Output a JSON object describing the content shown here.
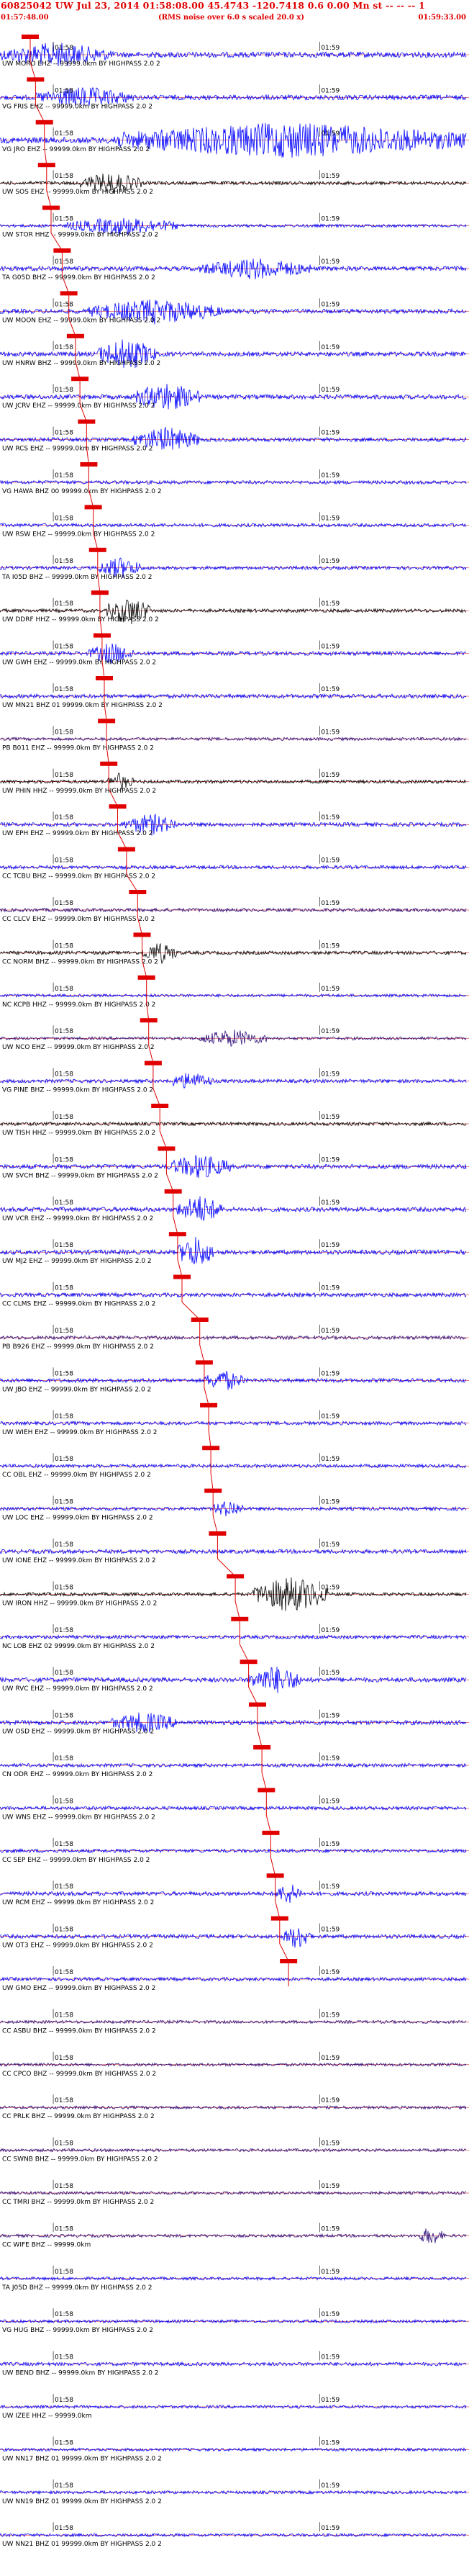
{
  "header": {
    "title": "60825042 UW Jul 23, 2014 01:58:08.00   45.4743 -120.7418  0.6 0.00 Mn st -- -- -- 1",
    "start_time": "01:57:48.00",
    "scale_note": "(RMS noise over 6.0 s scaled 20.0 x)",
    "end_time": "01:59:33.00",
    "colors": {
      "header": "#e00000",
      "pick": "#e00000",
      "trace_blue": "#0000ff",
      "trace_black": "#000000",
      "trace_purple": "#2a0a78",
      "baseline": "#d00000"
    }
  },
  "chart_data": {
    "type": "line",
    "description_units": "seconds after 01:57:48.00; amplitude relative (0-1)",
    "x_range": [
      0,
      105
    ],
    "tick_marks": [
      {
        "label": "01:58",
        "t": 12
      },
      {
        "label": "01:59",
        "t": 72
      }
    ],
    "series": [
      {
        "name": "UW MORO EHZ -- 99999.0km BY HIGHPASS 2.0 2",
        "pick": 6.8,
        "amp": 0.55,
        "color": "#0000ff",
        "ticks": "01:58|01:59",
        "burst": [
          [
            0,
            25,
            0.7
          ]
        ]
      },
      {
        "name": "VG FRIS EHZ -- 99999.0km BY HIGHPASS 2.0 2",
        "pick": 8.0,
        "amp": 0.5,
        "color": "#0000ff",
        "ticks": "01:58|01:59",
        "burst": [
          [
            8,
            30,
            0.6
          ]
        ]
      },
      {
        "name": "VG JRO EHZ -- 99999.0km BY HIGHPASS 2.0 2",
        "pick": 10.0,
        "amp": 0.6,
        "color": "#0000ff",
        "ticks": "01:58|01:59",
        "burst": [
          [
            25,
            105,
            1.0
          ]
        ]
      },
      {
        "name": "UW SOS EHZ -- 99999.0km BY HIGHPASS 2.0 2",
        "pick": 10.5,
        "amp": 0.35,
        "color": "#000000",
        "ticks": "01:58|01:59",
        "burst": [
          [
            18,
            32,
            0.6
          ]
        ]
      },
      {
        "name": "UW STOR HHZ -- 99999.0km BY HIGHPASS 2.0 2",
        "pick": 11.5,
        "amp": 0.3,
        "color": "#0000ff",
        "ticks": "01:58|01:59",
        "burst": [
          [
            15,
            40,
            0.5
          ]
        ]
      },
      {
        "name": "TA G05D BHZ -- 99999.0km BY HIGHPASS 2.0 2",
        "pick": 14.0,
        "amp": 0.45,
        "color": "#0000ff",
        "ticks": "01:58|01:59",
        "burst": [
          [
            45,
            70,
            0.6
          ]
        ]
      },
      {
        "name": "UW MOON EHZ -- 99999.0km BY HIGHPASS 2.0 2",
        "pick": 15.5,
        "amp": 0.45,
        "color": "#0000ff",
        "ticks": "01:58|01:59",
        "burst": [
          [
            20,
            50,
            0.7
          ]
        ]
      },
      {
        "name": "UW HNRW BHZ -- 99999.0km BY HIGHPASS 2.0 2",
        "pick": 17.0,
        "amp": 0.45,
        "color": "#0000ff",
        "ticks": "01:58|01:59",
        "burst": [
          [
            22,
            35,
            0.9
          ]
        ]
      },
      {
        "name": "UW JCRV EHZ -- 99999.0km BY HIGHPASS 2.0 2",
        "pick": 18.0,
        "amp": 0.45,
        "color": "#0000ff",
        "ticks": "01:58|01:59",
        "burst": [
          [
            30,
            45,
            0.8
          ]
        ]
      },
      {
        "name": "UW RCS EHZ -- 99999.0km BY HIGHPASS 2.0 2",
        "pick": 19.5,
        "amp": 0.4,
        "color": "#0000ff",
        "ticks": "01:58|01:59",
        "burst": [
          [
            30,
            45,
            0.7
          ]
        ]
      },
      {
        "name": "VG HAWA BHZ 00 99999.0km BY HIGHPASS 2.0 2",
        "pick": 20.0,
        "amp": 0.35,
        "color": "#0000ff",
        "ticks": "01:58|01:59",
        "burst": []
      },
      {
        "name": "UW RSW EHZ -- 99999.0km BY HIGHPASS 2.0 2",
        "pick": 21.0,
        "amp": 0.35,
        "color": "#0000ff",
        "ticks": "01:58|01:59",
        "burst": []
      },
      {
        "name": "TA I05D BHZ -- 99999.0km BY HIGHPASS 2.0 2",
        "pick": 22.0,
        "amp": 0.35,
        "color": "#0000ff",
        "ticks": "01:58|01:59",
        "burst": [
          [
            22,
            32,
            0.6
          ]
        ]
      },
      {
        "name": "UW DDRF HHZ -- 99999.0km BY HIGHPASS 2.0 2",
        "pick": 22.5,
        "amp": 0.35,
        "color": "#000000",
        "ticks": "01:58|01:59",
        "burst": [
          [
            24,
            34,
            0.8
          ]
        ]
      },
      {
        "name": "UW GWH EHZ -- 99999.0km BY HIGHPASS 2.0 2",
        "pick": 23.0,
        "amp": 0.4,
        "color": "#0000ff",
        "ticks": "01:58|01:59",
        "burst": [
          [
            20,
            30,
            0.6
          ]
        ]
      },
      {
        "name": "UW MN21 BHZ 01 99999.0km BY HIGHPASS 2.0 2",
        "pick": 23.5,
        "amp": 0.4,
        "color": "#0000ff",
        "ticks": "01:58|01:59",
        "burst": []
      },
      {
        "name": "PB B011 EHZ -- 99999.0km BY HIGHPASS 2.0 2",
        "pick": 24.0,
        "amp": 0.3,
        "color": "#2a0a78",
        "ticks": "01:58|01:59",
        "burst": []
      },
      {
        "name": "UW PHIN HHZ -- 99999.0km BY HIGHPASS 2.0 2",
        "pick": 24.5,
        "amp": 0.35,
        "color": "#000000",
        "ticks": "01:58|01:59",
        "burst": [
          [
            24,
            30,
            0.5
          ]
        ]
      },
      {
        "name": "UW EPH EHZ -- 99999.0km BY HIGHPASS 2.0 2",
        "pick": 26.5,
        "amp": 0.4,
        "color": "#0000ff",
        "ticks": "01:58|01:59",
        "burst": [
          [
            28,
            40,
            0.6
          ]
        ]
      },
      {
        "name": "CC TCBU BHZ -- 99999.0km BY HIGHPASS 2.0 2",
        "pick": 28.5,
        "amp": 0.35,
        "color": "#0000ff",
        "ticks": "01:58|01:59",
        "burst": []
      },
      {
        "name": "CC CLCV EHZ -- 99999.0km BY HIGHPASS 2.0 2",
        "pick": 31.0,
        "amp": 0.35,
        "color": "#2a0a78",
        "ticks": "01:58|01:59",
        "burst": []
      },
      {
        "name": "CC NORM BHZ -- 99999.0km BY HIGHPASS 2.0 2",
        "pick": 32.0,
        "amp": 0.35,
        "color": "#000000",
        "ticks": "01:58|01:59",
        "burst": [
          [
            32,
            40,
            0.6
          ]
        ]
      },
      {
        "name": "NC KCPB HHZ -- 99999.0km BY HIGHPASS 2.0 2",
        "pick": 33.0,
        "amp": 0.3,
        "color": "#0000ff",
        "ticks": "01:58|01:59",
        "burst": []
      },
      {
        "name": "UW NCO EHZ -- 99999.0km BY HIGHPASS 2.0 2",
        "pick": 33.5,
        "amp": 0.3,
        "color": "#2a0a78",
        "ticks": "01:58|01:59",
        "burst": [
          [
            45,
            60,
            0.5
          ]
        ]
      },
      {
        "name": "VG PINE BHZ -- 99999.0km BY HIGHPASS 2.0 2",
        "pick": 34.5,
        "amp": 0.35,
        "color": "#0000ff",
        "ticks": "01:58|01:59",
        "burst": [
          [
            38,
            48,
            0.5
          ]
        ]
      },
      {
        "name": "UW TISH HHZ -- 99999.0km BY HIGHPASS 2.0 2",
        "pick": 36.0,
        "amp": 0.35,
        "color": "#000000",
        "ticks": "01:58|01:59",
        "burst": []
      },
      {
        "name": "UW SVCH BHZ -- 99999.0km BY HIGHPASS 2.0 2",
        "pick": 37.5,
        "amp": 0.45,
        "color": "#0000ff",
        "ticks": "01:58|01:59",
        "burst": [
          [
            38,
            52,
            0.7
          ]
        ]
      },
      {
        "name": "UW VCR EHZ -- 99999.0km BY HIGHPASS 2.0 2",
        "pick": 39.0,
        "amp": 0.45,
        "color": "#0000ff",
        "ticks": "01:58|01:59",
        "burst": [
          [
            40,
            50,
            0.8
          ]
        ]
      },
      {
        "name": "UW MJ2 EHZ -- 99999.0km BY HIGHPASS 2.0 2",
        "pick": 40.0,
        "amp": 0.45,
        "color": "#0000ff",
        "ticks": "01:58|01:59",
        "burst": [
          [
            40,
            48,
            0.9
          ]
        ]
      },
      {
        "name": "CC CLMS EHZ -- 99999.0km BY HIGHPASS 2.0 2",
        "pick": 41.0,
        "amp": 0.4,
        "color": "#0000ff",
        "ticks": "01:58|01:59",
        "burst": []
      },
      {
        "name": "PB B926 EHZ -- 99999.0km BY HIGHPASS 2.0 2",
        "pick": 45.0,
        "amp": 0.35,
        "color": "#2a0a78",
        "ticks": "01:58|01:59",
        "burst": []
      },
      {
        "name": "UW JBO EHZ -- 99999.0km BY HIGHPASS 2.0 2",
        "pick": 46.0,
        "amp": 0.4,
        "color": "#0000ff",
        "ticks": "01:58|01:59",
        "burst": [
          [
            46,
            55,
            0.6
          ]
        ]
      },
      {
        "name": "UW WIEH EHZ -- 99999.0km BY HIGHPASS 2.0 2",
        "pick": 47.0,
        "amp": 0.35,
        "color": "#0000ff",
        "ticks": "01:58|01:59",
        "burst": []
      },
      {
        "name": "CC OBL EHZ -- 99999.0km BY HIGHPASS 2.0 2",
        "pick": 47.5,
        "amp": 0.35,
        "color": "#0000ff",
        "ticks": "01:58|01:59",
        "burst": []
      },
      {
        "name": "UW LOC EHZ -- 99999.0km BY HIGHPASS 2.0 2",
        "pick": 48.0,
        "amp": 0.35,
        "color": "#0000ff",
        "ticks": "01:58|01:59",
        "burst": [
          [
            48,
            55,
            0.5
          ]
        ]
      },
      {
        "name": "UW IONE EHZ -- 99999.0km BY HIGHPASS 2.0 2",
        "pick": 49.0,
        "amp": 0.4,
        "color": "#0000ff",
        "ticks": "01:58|01:59",
        "burst": []
      },
      {
        "name": "UW IRON HHZ -- 99999.0km BY HIGHPASS 2.0 2",
        "pick": 53.0,
        "amp": 0.35,
        "color": "#000000",
        "ticks": "01:58|01:59",
        "burst": [
          [
            57,
            74,
            1.0
          ]
        ]
      },
      {
        "name": "NC LOB EHZ 02 99999.0km BY HIGHPASS 2.0 2",
        "pick": 54.0,
        "amp": 0.35,
        "color": "#0000ff",
        "ticks": "01:58|01:59",
        "burst": []
      },
      {
        "name": "UW RVC EHZ -- 99999.0km BY HIGHPASS 2.0 2",
        "pick": 56.0,
        "amp": 0.45,
        "color": "#0000ff",
        "ticks": "01:58|01:59",
        "burst": [
          [
            56,
            68,
            0.8
          ]
        ]
      },
      {
        "name": "UW OSD EHZ -- 99999.0km BY HIGHPASS 2.0 2",
        "pick": 58.0,
        "amp": 0.45,
        "color": "#0000ff",
        "ticks": "01:58|01:59",
        "burst": [
          [
            25,
            40,
            0.6
          ]
        ]
      },
      {
        "name": "CN ODR EHZ -- 99999.0km BY HIGHPASS 2.0 2",
        "pick": 59.0,
        "amp": 0.35,
        "color": "#0000ff",
        "ticks": "01:58|01:59",
        "burst": []
      },
      {
        "name": "UW WNS EHZ -- 99999.0km BY HIGHPASS 2.0 2",
        "pick": 60.0,
        "amp": 0.35,
        "color": "#0000ff",
        "ticks": "01:58|01:59",
        "burst": []
      },
      {
        "name": "CC SEP EHZ -- 99999.0km BY HIGHPASS 2.0 2",
        "pick": 61.0,
        "amp": 0.35,
        "color": "#0000ff",
        "ticks": "01:58|01:59",
        "burst": []
      },
      {
        "name": "UW RCM EHZ -- 99999.0km BY HIGHPASS 2.0 2",
        "pick": 62.0,
        "amp": 0.4,
        "color": "#0000ff",
        "ticks": "01:58|01:59",
        "burst": [
          [
            62,
            68,
            0.6
          ]
        ]
      },
      {
        "name": "UW OT3 EHZ -- 99999.0km BY HIGHPASS 2.0 2",
        "pick": 63.0,
        "amp": 0.4,
        "color": "#0000ff",
        "ticks": "01:58|01:59",
        "burst": [
          [
            64,
            70,
            0.7
          ]
        ]
      },
      {
        "name": "UW GMO EHZ -- 99999.0km BY HIGHPASS 2.0 2",
        "pick": 65.0,
        "amp": 0.35,
        "color": "#0000ff",
        "ticks": "01:58|01:59",
        "burst": []
      },
      {
        "name": "CC ASBU BHZ -- 99999.0km BY HIGHPASS 2.0 2",
        "pick": null,
        "amp": 0.3,
        "color": "#2a0a78",
        "ticks": "01:58|01:59",
        "burst": []
      },
      {
        "name": "CC CPCO BHZ -- 99999.0km BY HIGHPASS 2.0 2",
        "pick": null,
        "amp": 0.3,
        "color": "#2a0a78",
        "ticks": "01:58|01:59",
        "burst": []
      },
      {
        "name": "CC PRLK BHZ -- 99999.0km BY HIGHPASS 2.0 2",
        "pick": null,
        "amp": 0.3,
        "color": "#2a0a78",
        "ticks": "01:58|01:59",
        "burst": []
      },
      {
        "name": "CC SWNB BHZ -- 99999.0km BY HIGHPASS 2.0 2",
        "pick": null,
        "amp": 0.3,
        "color": "#2a0a78",
        "ticks": "01:58|01:59",
        "burst": []
      },
      {
        "name": "CC TMRI BHZ -- 99999.0km BY HIGHPASS 2.0 2",
        "pick": null,
        "amp": 0.3,
        "color": "#2a0a78",
        "ticks": "01:58|01:59",
        "burst": []
      },
      {
        "name": "CC WIFE BHZ -- 99999.0km",
        "pick": null,
        "amp": 0.3,
        "color": "#2a0a78",
        "ticks": "01:58|01:59",
        "burst": [
          [
            94,
            100,
            0.5
          ]
        ]
      },
      {
        "name": "TA J05D BHZ -- 99999.0km BY HIGHPASS 2.0 2",
        "pick": null,
        "amp": 0.3,
        "color": "#0000ff",
        "ticks": "01:58|01:59",
        "burst": []
      },
      {
        "name": "VG HUG BHZ -- 99999.0km BY HIGHPASS 2.0 2",
        "pick": null,
        "amp": 0.3,
        "color": "#0000ff",
        "ticks": "01:58|01:59",
        "burst": []
      },
      {
        "name": "UW BEND BHZ -- 99999.0km BY HIGHPASS 2.0 2",
        "pick": null,
        "amp": 0.35,
        "color": "#0000ff",
        "ticks": "01:58|01:59",
        "burst": []
      },
      {
        "name": "UW IZEE HHZ -- 99999.0km",
        "pick": null,
        "amp": 0.3,
        "color": "#0000ff",
        "ticks": "01:58|01:59",
        "burst": []
      },
      {
        "name": "UW NN17 BHZ 01 99999.0km BY HIGHPASS 2.0 2",
        "pick": null,
        "amp": 0.3,
        "color": "#0000ff",
        "ticks": "01:58|01:59",
        "burst": []
      },
      {
        "name": "UW NN19 BHZ 01 99999.0km BY HIGHPASS 2.0 2",
        "pick": null,
        "amp": 0.3,
        "color": "#0000ff",
        "ticks": "01:58|01:59",
        "burst": []
      },
      {
        "name": "UW NN21 BHZ 01 99999.0km BY HIGHPASS 2.0 2",
        "pick": null,
        "amp": 0.3,
        "color": "#0000ff",
        "ticks": "01:58|01:59",
        "burst": []
      }
    ]
  }
}
